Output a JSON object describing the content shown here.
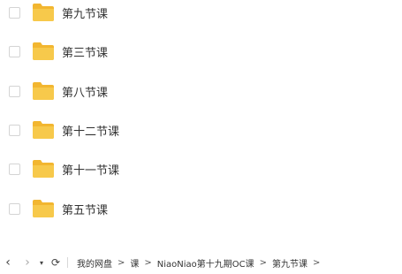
{
  "files": [
    {
      "name": "第九节课"
    },
    {
      "name": "第三节课"
    },
    {
      "name": "第八节课"
    },
    {
      "name": "第十二节课"
    },
    {
      "name": "第十一节课"
    },
    {
      "name": "第五节课"
    }
  ],
  "nav": {
    "back_glyph": "‹",
    "forward_glyph": "›",
    "dropdown_glyph": "▾",
    "refresh_glyph": "⟳"
  },
  "breadcrumb": {
    "items": [
      "我的网盘",
      "课",
      "NiaoNiao第十九期OC课",
      "第九节课"
    ],
    "separator": ">"
  },
  "colors": {
    "folder": "#f7c94b",
    "folder_tab": "#f2b630"
  }
}
